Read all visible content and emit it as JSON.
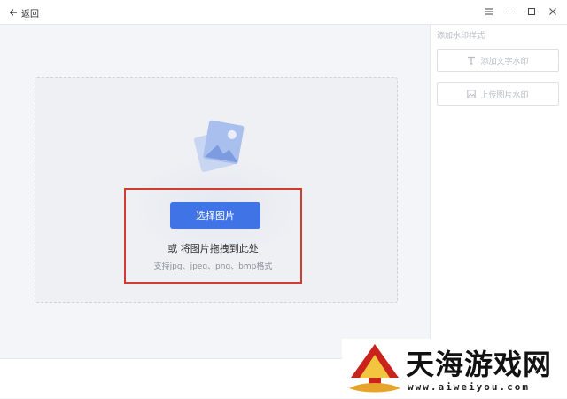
{
  "titlebar": {
    "back_label": "返回",
    "controls": [
      "menu-icon",
      "minimize-icon",
      "maximize-icon",
      "close-icon"
    ]
  },
  "dropzone": {
    "select_button_label": "选择图片",
    "drag_hint": "或 将图片拖拽到此处",
    "formats_hint": "支持jpg、jpeg、png、bmp格式"
  },
  "sidebar": {
    "title": "添加水印样式",
    "buttons": [
      {
        "label": "添加文字水印",
        "icon": "text-icon"
      },
      {
        "label": "上传图片水印",
        "icon": "image-icon"
      }
    ]
  },
  "watermark": {
    "name": "天海游戏网",
    "url": "www.aiweiyou.com"
  },
  "colors": {
    "accent": "#3f73e6",
    "highlight": "#d23b30",
    "workspace_bg": "#f4f5f8"
  }
}
